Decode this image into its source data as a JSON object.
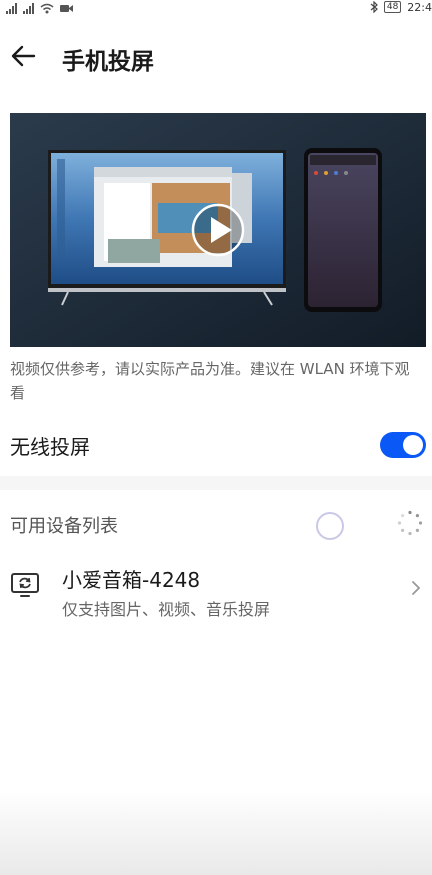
{
  "status_bar": {
    "time": "22:4",
    "battery": "48"
  },
  "header": {
    "title": "手机投屏"
  },
  "video": {
    "caption": "视频仅供参考，请以实际产品为准。建议在 WLAN 环境下观看"
  },
  "wireless": {
    "label": "无线投屏",
    "enabled": true
  },
  "devices": {
    "section_title": "可用设备列表",
    "items": [
      {
        "name": "小爱音箱-4248",
        "desc": "仅支持图片、视频、音乐投屏"
      }
    ]
  },
  "colors": {
    "accent": "#0a59f7",
    "background": "#f6f6f6"
  },
  "icons": [
    "back-arrow-icon",
    "play-icon",
    "loading-spinner-icon",
    "cast-device-icon",
    "chevron-right-icon",
    "bluetooth-icon"
  ]
}
